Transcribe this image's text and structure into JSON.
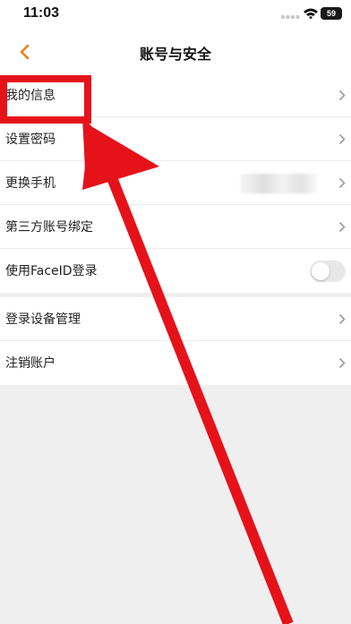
{
  "status_bar": {
    "time": "11:03",
    "battery": "59",
    "icons": [
      "signal-dots-icon",
      "wifi-icon",
      "battery-icon"
    ]
  },
  "nav": {
    "back_icon": "chevron-left-icon",
    "title": "账号与安全"
  },
  "groups": [
    {
      "rows": [
        {
          "label": "我的信息",
          "control": "chevron"
        },
        {
          "label": "设置密码",
          "control": "chevron"
        },
        {
          "label": "更换手机",
          "control": "chevron",
          "value": "(blurred)"
        },
        {
          "label": "第三方账号绑定",
          "control": "chevron"
        },
        {
          "label": "使用FaceID登录",
          "control": "toggle",
          "toggle_on": false
        }
      ]
    },
    {
      "rows": [
        {
          "label": "登录设备管理",
          "control": "chevron"
        },
        {
          "label": "注销账户",
          "control": "chevron"
        }
      ]
    }
  ],
  "colors": {
    "accent": "#f07d1b",
    "annotation": "#e6121a",
    "background": "#efefef",
    "card": "#ffffff"
  }
}
